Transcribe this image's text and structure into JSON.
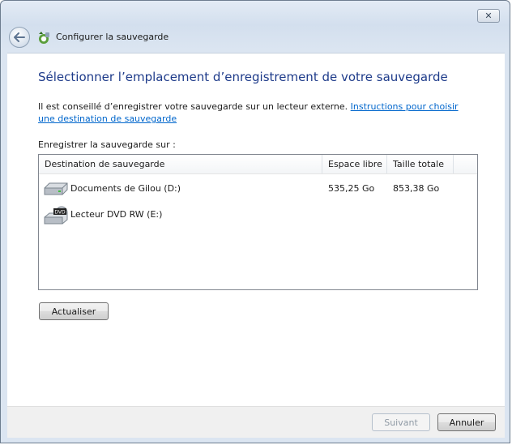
{
  "window": {
    "title": "Configurer la sauvegarde",
    "close_glyph": "✕"
  },
  "main": {
    "heading": "Sélectionner l’emplacement d’enregistrement de votre sauvegarde",
    "intro_text": "Il est conseillé d’enregistrer votre sauvegarde sur un lecteur externe. ",
    "intro_link": "Instructions pour choisir une destination de sauvegarde",
    "list_label": "Enregistrer la sauvegarde sur :",
    "columns": [
      "Destination de sauvegarde",
      "Espace libre",
      "Taille totale"
    ],
    "rows": [
      {
        "name": "Documents de Gilou (D:)",
        "free": "535,25 Go",
        "total": "853,38 Go",
        "icon": "hard-drive-icon"
      },
      {
        "name": "Lecteur DVD RW (E:)",
        "free": "",
        "total": "",
        "icon": "dvd-drive-icon"
      }
    ],
    "refresh_label": "Actualiser"
  },
  "footer": {
    "next_label": "Suivant",
    "cancel_label": "Annuler"
  },
  "colors": {
    "heading": "#1e3b8a",
    "link": "#0066cc"
  }
}
